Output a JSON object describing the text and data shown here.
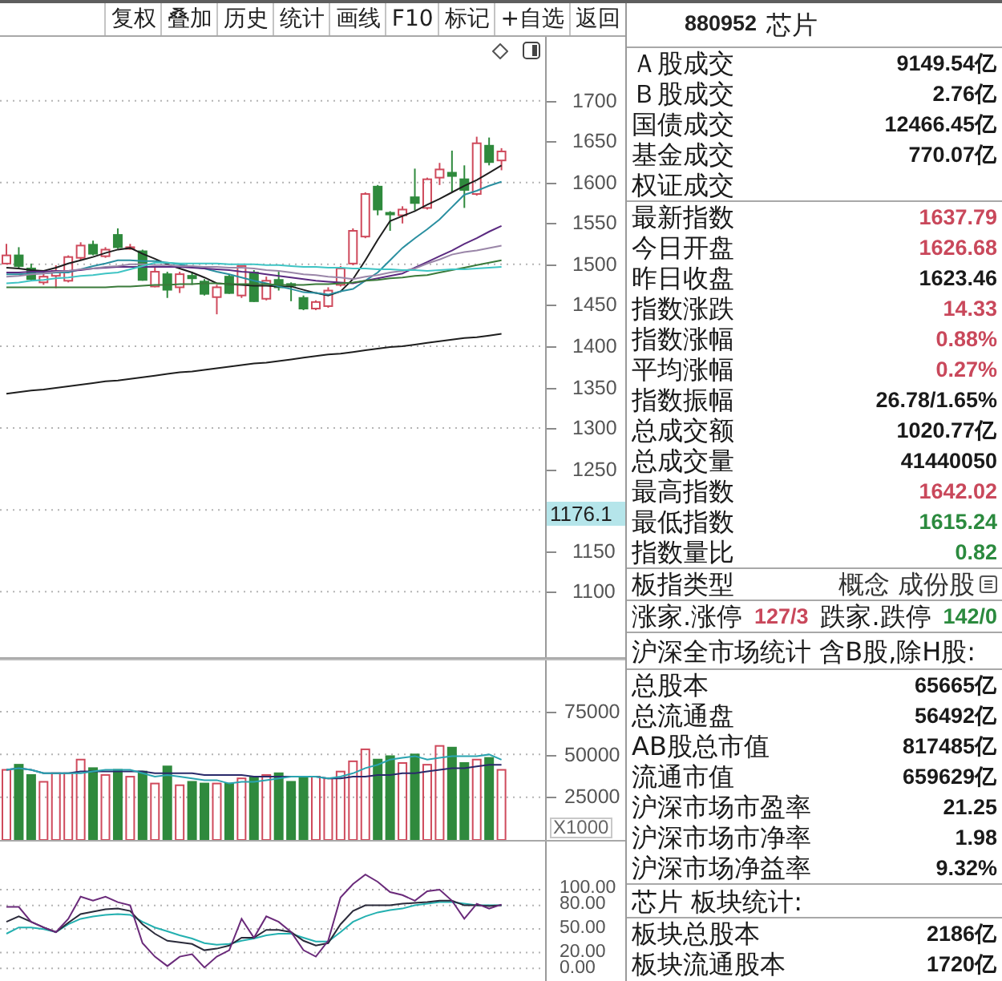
{
  "toolbar": {
    "buttons": [
      "复权",
      "叠加",
      "历史",
      "统计",
      "画线",
      "F10",
      "标记",
      "+自选",
      "返回"
    ]
  },
  "price_chart": {
    "cursor_label": "1176.1",
    "chart_data": {
      "type": "line",
      "grid": true,
      "ylim": [
        1020,
        1778
      ],
      "yticks": [
        {
          "value": 1700,
          "label": "1700"
        },
        {
          "value": 1650,
          "label": "1650"
        },
        {
          "value": 1600,
          "label": "1600"
        },
        {
          "value": 1550,
          "label": "1550"
        },
        {
          "value": 1500,
          "label": "1500"
        },
        {
          "value": 1450,
          "label": "1450"
        },
        {
          "value": 1400,
          "label": "1400"
        },
        {
          "value": 1350,
          "label": "1350"
        },
        {
          "value": 1300,
          "label": "1300"
        },
        {
          "value": 1250,
          "label": "1250"
        },
        {
          "value": 1150,
          "label": "1150"
        },
        {
          "value": 1100,
          "label": "1100"
        }
      ],
      "series": [
        {
          "type": "candlestick",
          "color": "#cf4a5c",
          "ohlc": [
            [
              1501,
              1525,
              1500,
              1511
            ],
            null,
            null,
            [
              1478,
              1491,
              1475,
              1485
            ],
            [
              1486,
              1499,
              1471,
              1492
            ],
            [
              1480,
              1511,
              1478,
              1509
            ],
            [
              1508,
              1527,
              1505,
              1523
            ],
            null,
            [
              1510,
              1521,
              1508,
              1518
            ],
            null,
            [
              1520,
              1525,
              1518,
              1521
            ],
            null,
            [
              1473,
              1498,
              1472,
              1491
            ],
            null,
            [
              1472,
              1491,
              1465,
              1488
            ],
            null,
            null,
            [
              1460,
              1475,
              1439,
              1472
            ],
            null,
            [
              1462,
              1499,
              1459,
              1498
            ],
            null,
            [
              1458,
              1485,
              1456,
              1480
            ],
            null,
            null,
            null,
            [
              1446,
              1456,
              1444,
              1454
            ],
            [
              1449,
              1472,
              1447,
              1468
            ],
            [
              1475,
              1498,
              1473,
              1495
            ],
            [
              1501,
              1544,
              1499,
              1541
            ],
            [
              1534,
              1588,
              1532,
              1586
            ],
            null,
            null,
            [
              1560,
              1571,
              1550,
              1567
            ],
            null,
            [
              1569,
              1606,
              1567,
              1604
            ],
            [
              1606,
              1624,
              1597,
              1616
            ],
            null,
            null,
            [
              1586,
              1656,
              1584,
              1648
            ],
            null,
            [
              1627,
              1642,
              1615,
              1638
            ]
          ]
        },
        {
          "type": "candlestick",
          "color": "#2f8a3d",
          "ohlc": [
            null,
            [
              1511,
              1521,
              1495,
              1498
            ],
            [
              1495,
              1501,
              1480,
              1482
            ],
            null,
            null,
            null,
            null,
            [
              1524,
              1529,
              1511,
              1513
            ],
            null,
            [
              1536,
              1544,
              1519,
              1521
            ],
            null,
            [
              1516,
              1518,
              1480,
              1481
            ],
            null,
            [
              1488,
              1491,
              1459,
              1469
            ],
            null,
            [
              1486,
              1491,
              1475,
              1483
            ],
            [
              1479,
              1482,
              1462,
              1464
            ],
            null,
            [
              1485,
              1488,
              1464,
              1465
            ],
            null,
            [
              1490,
              1493,
              1454,
              1455
            ],
            null,
            [
              1481,
              1491,
              1468,
              1472
            ],
            [
              1476,
              1478,
              1455,
              1474
            ],
            [
              1459,
              1462,
              1444,
              1446
            ],
            null,
            null,
            null,
            null,
            null,
            [
              1595,
              1597,
              1560,
              1567
            ],
            [
              1563,
              1565,
              1541,
              1561
            ],
            null,
            [
              1582,
              1617,
              1566,
              1575
            ],
            null,
            null,
            [
              1612,
              1639,
              1589,
              1608
            ],
            [
              1604,
              1621,
              1569,
              1591
            ],
            null,
            [
              1645,
              1655,
              1621,
              1625
            ],
            null
          ]
        },
        {
          "color": "#1e1e1e",
          "values": [
            1496,
            1495,
            1493,
            1492,
            1496,
            1501,
            1505,
            1509,
            1514,
            1518,
            1520,
            1513,
            1507,
            1500,
            1495,
            1490,
            1484,
            1477,
            1476,
            1475,
            1474,
            1474,
            1473,
            1473,
            1469,
            1465,
            1462,
            1467,
            1482,
            1505,
            1530,
            1553,
            1559,
            1565,
            1573,
            1580,
            1588,
            1596,
            1603,
            1612,
            1621
          ]
        },
        {
          "color": "#2a8fa0",
          "values": [
            1488,
            1488,
            1489,
            1489,
            1490,
            1490,
            1494,
            1498,
            1501,
            1505,
            1505,
            1504,
            1504,
            1502,
            1500,
            1497,
            1495,
            1491,
            1488,
            1484,
            1480,
            1477,
            1473,
            1470,
            1466,
            1465,
            1463,
            1467,
            1470,
            1480,
            1490,
            1505,
            1520,
            1532,
            1543,
            1555,
            1570,
            1585,
            1590,
            1596,
            1601
          ]
        },
        {
          "color": "#5b2a80",
          "values": [
            1490,
            1490,
            1491,
            1491,
            1492,
            1492,
            1493,
            1495,
            1496,
            1497,
            1497,
            1497,
            1497,
            1497,
            1497,
            1496,
            1495,
            1494,
            1493,
            1491,
            1490,
            1488,
            1486,
            1484,
            1482,
            1480,
            1479,
            1478,
            1477,
            1480,
            1483,
            1486,
            1489,
            1496,
            1503,
            1510,
            1517,
            1525,
            1532,
            1540,
            1547
          ]
        },
        {
          "color": "#9a86a8",
          "values": [
            1485,
            1486,
            1488,
            1489,
            1491,
            1492,
            1494,
            1495,
            1497,
            1498,
            1500,
            1500,
            1499,
            1499,
            1498,
            1498,
            1497,
            1497,
            1496,
            1496,
            1495,
            1493,
            1492,
            1490,
            1488,
            1487,
            1485,
            1484,
            1482,
            1485,
            1487,
            1490,
            1492,
            1495,
            1501,
            1506,
            1512,
            1515,
            1517,
            1520,
            1523
          ]
        },
        {
          "color": "#3a7a3a",
          "values": [
            1472,
            1472,
            1472,
            1472,
            1472,
            1472,
            1472,
            1472,
            1472,
            1473,
            1473,
            1474,
            1475,
            1475,
            1476,
            1476,
            1477,
            1477,
            1476,
            1476,
            1476,
            1476,
            1475,
            1475,
            1475,
            1476,
            1476,
            1477,
            1478,
            1480,
            1481,
            1483,
            1484,
            1486,
            1487,
            1490,
            1493,
            1496,
            1499,
            1502,
            1505
          ]
        },
        {
          "color": "#3fc4c4",
          "values": [
            1477,
            1478,
            1480,
            1481,
            1483,
            1484,
            1486,
            1487,
            1489,
            1490,
            1494,
            1498,
            1502,
            1502,
            1501,
            1501,
            1501,
            1501,
            1500,
            1500,
            1500,
            1499,
            1499,
            1498,
            1497,
            1497,
            1496,
            1496,
            1495,
            1495,
            1494,
            1494,
            1493,
            1493,
            1492,
            1493,
            1494,
            1494,
            1495,
            1496,
            1497
          ]
        },
        {
          "color": "#1e1e1e",
          "values": [
            1342,
            1344,
            1346,
            1347,
            1349,
            1351,
            1353,
            1355,
            1357,
            1358,
            1360,
            1362,
            1364,
            1366,
            1368,
            1369,
            1371,
            1373,
            1375,
            1377,
            1379,
            1380,
            1382,
            1384,
            1386,
            1388,
            1390,
            1391,
            1393,
            1395,
            1397,
            1399,
            1400,
            1402,
            1404,
            1406,
            1408,
            1410,
            1411,
            1413,
            1415
          ]
        }
      ]
    }
  },
  "volume_chart": {
    "unit": "X1000",
    "chart_data": {
      "type": "bar",
      "grid": true,
      "ylim": [
        0,
        105000
      ],
      "yticks": [
        {
          "value": 75000,
          "label": "75000"
        },
        {
          "value": 50000,
          "label": "50000"
        },
        {
          "value": 25000,
          "label": "25000"
        }
      ],
      "series": [
        {
          "color": "#cf4a5c",
          "values": [
            41000,
            null,
            null,
            34000,
            39000,
            39000,
            47000,
            null,
            38000,
            null,
            37000,
            null,
            33000,
            null,
            32000,
            null,
            null,
            33000,
            null,
            36000,
            null,
            38000,
            null,
            null,
            null,
            37000,
            36000,
            40000,
            46000,
            53000,
            null,
            null,
            45000,
            null,
            44000,
            55000,
            null,
            null,
            47000,
            null,
            41000
          ]
        },
        {
          "color": "#2f8a3d",
          "values": [
            null,
            44000,
            38000,
            null,
            null,
            null,
            null,
            42000,
            null,
            41000,
            null,
            40000,
            null,
            43000,
            null,
            34000,
            33000,
            null,
            33000,
            null,
            37000,
            null,
            39000,
            34000,
            37000,
            null,
            null,
            null,
            null,
            null,
            47000,
            49000,
            null,
            50000,
            null,
            null,
            54000,
            45000,
            null,
            48000,
            null
          ]
        },
        {
          "type": "line",
          "color": "#2a2a6a",
          "values": [
            41000,
            42000,
            41000,
            39000,
            39000,
            39000,
            40000,
            40000,
            40000,
            40000,
            40000,
            40000,
            39000,
            39000,
            39000,
            39000,
            38000,
            38000,
            38000,
            38000,
            37000,
            37000,
            37000,
            37000,
            37000,
            37000,
            36000,
            36000,
            37000,
            37000,
            38000,
            38000,
            39000,
            39000,
            40000,
            41000,
            42000,
            42000,
            43000,
            44000,
            44000
          ]
        },
        {
          "type": "line",
          "color": "#2aa3b0",
          "values": [
            41000,
            42000,
            41000,
            39000,
            39000,
            39000,
            39000,
            40000,
            41000,
            41000,
            41000,
            39000,
            37000,
            38000,
            37000,
            36000,
            35000,
            35000,
            33000,
            34000,
            34000,
            35000,
            36000,
            37000,
            37000,
            37000,
            36000,
            37000,
            39000,
            42000,
            44000,
            47000,
            48000,
            49000,
            47000,
            48000,
            49000,
            49000,
            49000,
            50000,
            47000
          ]
        }
      ]
    }
  },
  "indicator_chart": {
    "chart_data": {
      "type": "line",
      "grid": true,
      "ylim": [
        -16,
        161
      ],
      "yticks": [
        {
          "value": 100,
          "label": "100.00"
        },
        {
          "value": 80,
          "label": "80.00"
        },
        {
          "value": 50,
          "label": "50.00"
        },
        {
          "value": 20,
          "label": "20.00"
        },
        {
          "value": 0,
          "label": "0.00"
        }
      ],
      "series": [
        {
          "color": "#23b0b0",
          "values": [
            44,
            52,
            52,
            50,
            46,
            56,
            63,
            66,
            68,
            69,
            68,
            59,
            52,
            47,
            42,
            38,
            32,
            30,
            31,
            35,
            38,
            42,
            44,
            44,
            39,
            34,
            34,
            46,
            59,
            66,
            71,
            74,
            76,
            80,
            82,
            84,
            84,
            82,
            80,
            80,
            80
          ]
        },
        {
          "color": "#2a2a3a",
          "values": [
            59,
            66,
            59,
            52,
            46,
            58,
            69,
            72,
            75,
            76,
            73,
            56,
            44,
            35,
            33,
            31,
            23,
            25,
            29,
            39,
            39,
            49,
            49,
            46,
            35,
            29,
            32,
            56,
            73,
            80,
            80,
            80,
            82,
            83,
            84,
            86,
            86,
            80,
            80,
            79,
            80
          ]
        },
        {
          "color": "#6a2a7a",
          "values": [
            78,
            78,
            59,
            52,
            46,
            63,
            91,
            86,
            91,
            84,
            80,
            32,
            15,
            3,
            15,
            18,
            1,
            15,
            23,
            63,
            39,
            66,
            59,
            46,
            23,
            15,
            35,
            90,
            107,
            119,
            110,
            97,
            93,
            86,
            98,
            100,
            86,
            63,
            82,
            76,
            81
          ]
        }
      ]
    }
  },
  "quote_panel": {
    "code": "880952",
    "name": "芯片",
    "turnover": [
      {
        "label": "Ａ股成交",
        "value": "9149.54亿"
      },
      {
        "label": "Ｂ股成交",
        "value": "2.76亿"
      },
      {
        "label": "国债成交",
        "value": "12466.45亿"
      },
      {
        "label": "基金成交",
        "value": "770.07亿"
      },
      {
        "label": "权证成交"
      }
    ],
    "index_stats": [
      {
        "label": "最新指数",
        "value": "1637.79",
        "color": "#c9485b"
      },
      {
        "label": "今日开盘",
        "value": "1626.68",
        "color": "#c9485b"
      },
      {
        "label": "昨日收盘",
        "value": "1623.46",
        "color": "#1a1a1a"
      },
      {
        "label": "指数涨跌",
        "value": "14.33",
        "color": "#c9485b"
      },
      {
        "label": "指数涨幅",
        "value": "0.88%",
        "color": "#c9485b"
      },
      {
        "label": "平均涨幅",
        "value": "0.27%",
        "color": "#c9485b"
      },
      {
        "label": "指数振幅",
        "value": "26.78/1.65%",
        "color": "#1a1a1a"
      },
      {
        "label": "总成交额",
        "value": "1020.77亿",
        "color": "#1a1a1a"
      },
      {
        "label": "总成交量",
        "value": "41440050",
        "color": "#1a1a1a"
      },
      {
        "label": "最高指数",
        "value": "1642.02",
        "color": "#c9485b"
      },
      {
        "label": "最低指数",
        "value": "1615.24",
        "color": "#2b8a3e"
      },
      {
        "label": "指数量比",
        "value": "0.82",
        "color": "#2b8a3e"
      }
    ],
    "board_type": {
      "label": "板指类型",
      "value": "概念 成份股"
    },
    "breadth": [
      {
        "label": "涨家.涨停",
        "value": "127/3",
        "color": "#c9485b"
      },
      {
        "label": "跌家.跌停",
        "value": "142/0",
        "color": "#2b8a3e"
      }
    ],
    "market_title": "沪深全市场统计 含B股,除H股:",
    "market_stats": [
      {
        "label": "总股本",
        "value": "65665亿"
      },
      {
        "label": "总流通盘",
        "value": "56492亿"
      },
      {
        "label": "AB股总市值",
        "value": "817485亿"
      },
      {
        "label": "流通市值",
        "value": "659629亿"
      },
      {
        "label": "沪深市场市盈率",
        "value": "21.25"
      },
      {
        "label": "沪深市场市净率",
        "value": "1.98"
      },
      {
        "label": "沪深市场净益率",
        "value": "9.32%"
      }
    ],
    "sector_title": "芯片 板块统计:",
    "sector_stats": [
      {
        "label": "板块总股本",
        "value": "2186亿"
      },
      {
        "label": "板块流通股本",
        "value": "1720亿"
      }
    ]
  }
}
